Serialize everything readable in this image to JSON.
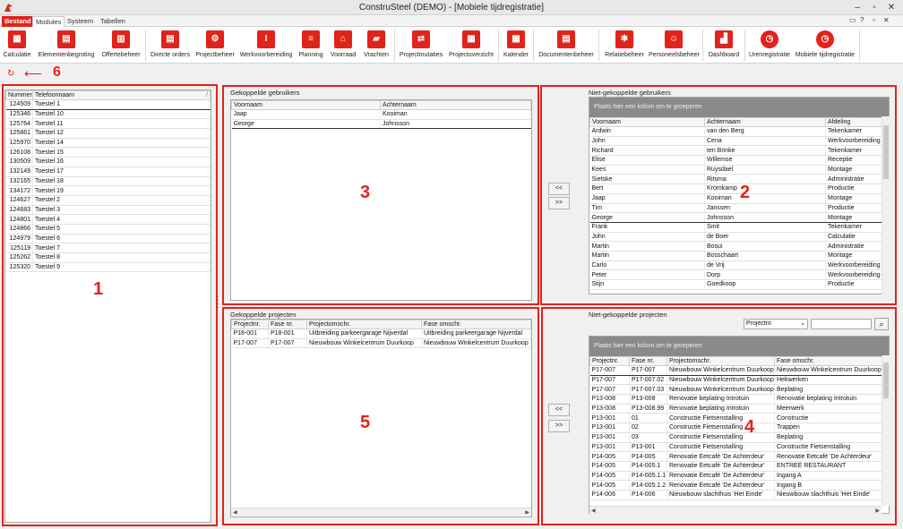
{
  "window": {
    "title": "ConstruSteel (DEMO) - [Mobiele tijdregistratie]"
  },
  "menu": {
    "tabs": [
      "Bestand",
      "Modules",
      "Systeem",
      "Tabellen"
    ]
  },
  "ribbon": {
    "buttons": [
      "Calculatie",
      "Elementenbegroting",
      "Offertebeheer",
      "Directe orders",
      "Projectbeheer",
      "Werkvoorbereiding",
      "Planning",
      "Voorraad",
      "Vrachten",
      "Projectmutaties",
      "Projectoverzicht",
      "Kalender",
      "Documentenbeheer",
      "Relatiebeheer",
      "Personeelsbeheer",
      "Dashboard",
      "Urenregistratie",
      "Mobiele tijdregistratie"
    ]
  },
  "labels": {
    "n1": "1",
    "n2": "2",
    "n3": "3",
    "n4": "4",
    "n5": "5",
    "n6": "6"
  },
  "devices": {
    "headers": [
      "Nummer",
      "Telefoonnaam"
    ],
    "rows": [
      [
        "124509",
        "Toestel 1"
      ],
      [
        "125346",
        "Toestel 10"
      ],
      [
        "125764",
        "Toestel 11"
      ],
      [
        "125861",
        "Toestel 12"
      ],
      [
        "125970",
        "Toestel 14"
      ],
      [
        "126108",
        "Toestel 15"
      ],
      [
        "130509",
        "Toestel 16"
      ],
      [
        "132149",
        "Toestel 17"
      ],
      [
        "132165",
        "Toestel 18"
      ],
      [
        "134172",
        "Toestel 19"
      ],
      [
        "124627",
        "Toestel 2"
      ],
      [
        "124683",
        "Toestel 3"
      ],
      [
        "124801",
        "Toestel 4"
      ],
      [
        "124866",
        "Toestel 5"
      ],
      [
        "124979",
        "Toestel 6"
      ],
      [
        "125119",
        "Toestel 7"
      ],
      [
        "125262",
        "Toestel 8"
      ],
      [
        "125320",
        "Toestel 9"
      ]
    ]
  },
  "linked_users": {
    "title": "Gekoppelde gebruikers",
    "headers": [
      "Voornaam",
      "Achternaam"
    ],
    "rows": [
      [
        "Jaap",
        "Kooiman"
      ],
      [
        "George",
        "Johnsson"
      ]
    ]
  },
  "unlinked_users": {
    "title": "Niet-gekoppelde gebruikers",
    "group_hint": "Plaats hier een kolom om te groeperen",
    "headers": [
      "Voornaam",
      "Achternaam",
      "Afdeling"
    ],
    "rows": [
      [
        "Ardwin",
        "van den Berg",
        "Tekenkamer"
      ],
      [
        "John",
        "Cena",
        "Werkvoorbereiding"
      ],
      [
        "Richard",
        "ten Brinke",
        "Tekenkamer"
      ],
      [
        "Elise",
        "Willemse",
        "Receptie"
      ],
      [
        "Kees",
        "Ruysdael",
        "Montage"
      ],
      [
        "Sietske",
        "Ritsma",
        "Administratie"
      ],
      [
        "Bert",
        "Kromkamp",
        "Productie"
      ],
      [
        "Jaap",
        "Kooiman",
        "Montage"
      ],
      [
        "Tim",
        "Janssen",
        "Productie"
      ],
      [
        "George",
        "Johnsson",
        "Montage"
      ],
      [
        "Frank",
        "Smit",
        "Tekenkamer"
      ],
      [
        "John",
        "de Boer",
        "Calculatie"
      ],
      [
        "Martin",
        "Bosui",
        "Administratie"
      ],
      [
        "Martin",
        "Bosschaart",
        "Montage"
      ],
      [
        "Carlo",
        "de Vrij",
        "Werkvoorbereiding"
      ],
      [
        "Peter",
        "Dorp",
        "Werkvoorbereiding"
      ],
      [
        "Stijn",
        "Goedkoop",
        "Productie"
      ]
    ]
  },
  "linked_projects": {
    "title": "Gekoppelde projecten",
    "headers": [
      "Projectnr.",
      "Fase nr.",
      "Projectomschr.",
      "Fase omschr."
    ],
    "rows": [
      [
        "P18-001",
        "P18-001",
        "Uitbreiding parkeergarage Nijverdal",
        "Uitbreiding parkeergarage Nijverdal"
      ],
      [
        "P17-007",
        "P17-007",
        "Nieuwbouw Winkelcentrum Duurkoop",
        "Nieuwbouw Winkelcentrum Duurkoop"
      ]
    ]
  },
  "unlinked_projects": {
    "title": "Niet-gekoppelde projecten",
    "group_hint": "Plaats hier een kolom om te groeperen",
    "filter_value": "Projectnr.",
    "headers": [
      "Projectnr.",
      "Fase nr.",
      "Projectomschr.",
      "Fase omschr."
    ],
    "rows": [
      [
        "P17-007",
        "P17-007",
        "Nieuwbouw Winkelcentrum Duurkoop",
        "Nieuwbouw Winkelcentrum Duurkoop"
      ],
      [
        "P17-007",
        "P17-007.02",
        "Nieuwbouw Winkelcentrum Duurkoop",
        "Hekwerken"
      ],
      [
        "P17-007",
        "P17-007.03",
        "Nieuwbouw Winkelcentrum Duurkoop",
        "Beplating"
      ],
      [
        "P13-008",
        "P13-008",
        "Renovatie beplating Introtuin",
        "Renovatie beplating Introtuin"
      ],
      [
        "P13-008",
        "P13-008.99",
        "Renovatie beplating Introtuin",
        "Meerwerk"
      ],
      [
        "P13-001",
        "01",
        "Constructie Fietsenstalling",
        "Constructie"
      ],
      [
        "P13-001",
        "02",
        "Constructie Fietsenstalling",
        "Trappen"
      ],
      [
        "P13-001",
        "03",
        "Constructie Fietsenstalling",
        "Beplating"
      ],
      [
        "P13-001",
        "P13-001",
        "Constructie Fietsenstalling",
        "Constructie Fietsenstalling"
      ],
      [
        "P14-005",
        "P14-005",
        "Renovatie Eetcafé 'De Achterdeur'",
        "Renovatie Eetcafé 'De Achterdeur'"
      ],
      [
        "P14-005",
        "P14-005.1",
        "Renovatie Eetcafé 'De Achterdeur'",
        "ENTREE RESTAURANT"
      ],
      [
        "P14-005",
        "P14-005.1.1",
        "Renovatie Eetcafé 'De Achterdeur'",
        "Ingang A"
      ],
      [
        "P14-005",
        "P14-005.1.2",
        "Renovatie Eetcafé 'De Achterdeur'",
        "Ingang B"
      ],
      [
        "P14-006",
        "P14-006",
        "Nieuwbouw slachthuis 'Het Einde'",
        "Nieuwbouw slachthuis 'Het Einde'"
      ]
    ]
  },
  "buttons": {
    "move_left": "<<",
    "move_right": ">>"
  }
}
